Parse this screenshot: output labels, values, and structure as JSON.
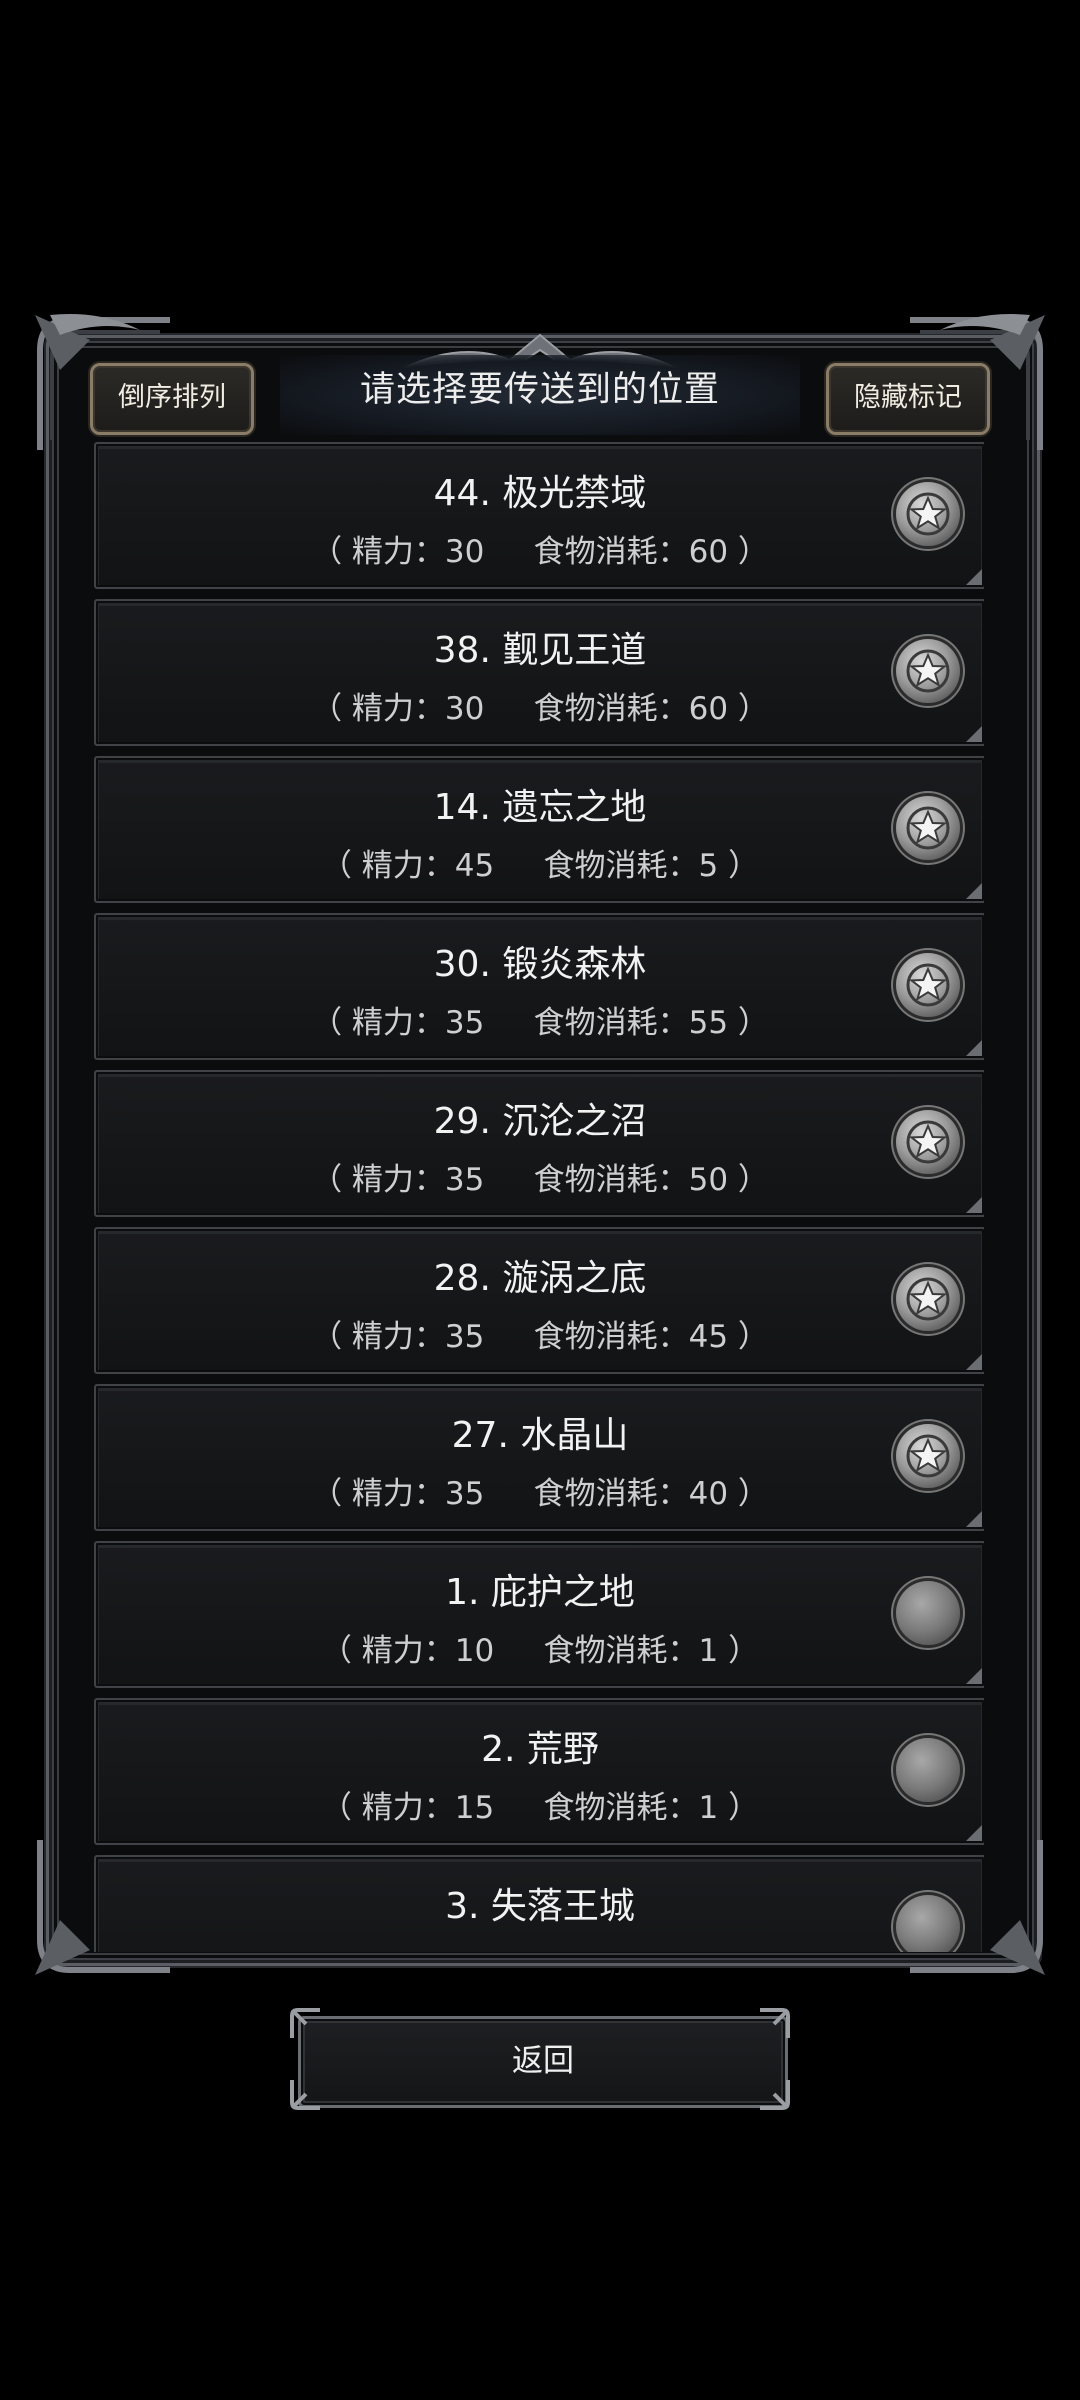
{
  "header": {
    "title": "请选择要传送到的位置",
    "sort_button": "倒序排列",
    "hide_button": "隐藏标记"
  },
  "locations": [
    {
      "name": "44. 极光禁域",
      "stats": "（ 精力：30     食物消耗：60 ）",
      "marked": true
    },
    {
      "name": "38. 觐见王道",
      "stats": "（ 精力：30     食物消耗：60 ）",
      "marked": true
    },
    {
      "name": "14. 遗忘之地",
      "stats": "（ 精力：45     食物消耗：5 ）",
      "marked": true
    },
    {
      "name": "30. 锻炎森林",
      "stats": "（ 精力：35     食物消耗：55 ）",
      "marked": true
    },
    {
      "name": "29. 沉沦之沼",
      "stats": "（ 精力：35     食物消耗：50 ）",
      "marked": true
    },
    {
      "name": "28. 漩涡之底",
      "stats": "（ 精力：35     食物消耗：45 ）",
      "marked": true
    },
    {
      "name": "27. 水晶山",
      "stats": "（ 精力：35     食物消耗：40 ）",
      "marked": true
    },
    {
      "name": "1. 庇护之地",
      "stats": "（ 精力：10     食物消耗：1 ）",
      "marked": false
    },
    {
      "name": "2. 荒野",
      "stats": "（ 精力：15     食物消耗：1 ）",
      "marked": false
    },
    {
      "name": "3. 失落王城",
      "stats": "",
      "marked": false
    }
  ],
  "icons": {
    "marked": "star-badge-icon",
    "unmarked": "empty-badge-icon"
  },
  "footer": {
    "back_label": "返回"
  }
}
